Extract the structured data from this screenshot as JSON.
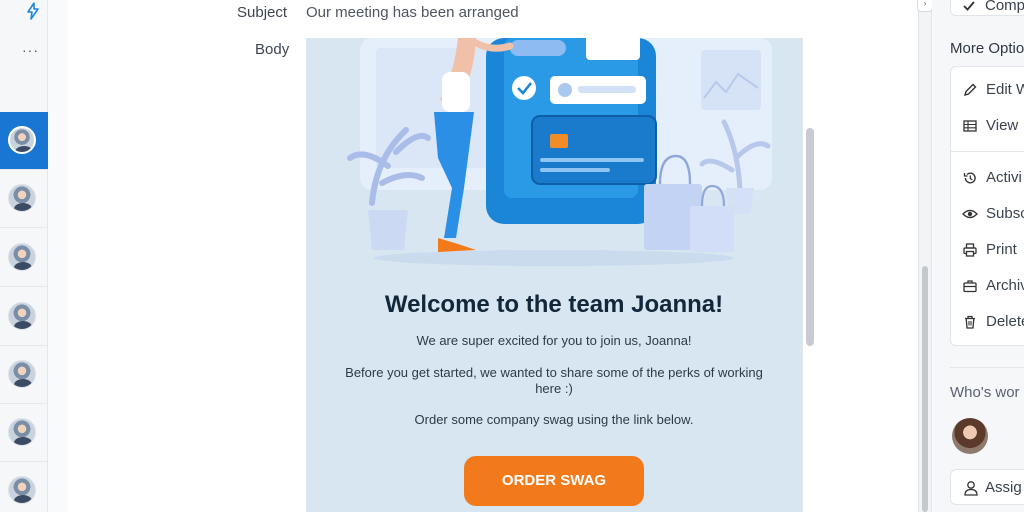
{
  "sidebar": {
    "more_label": "···",
    "threads": [
      {
        "active": true
      },
      {
        "active": false
      },
      {
        "active": false
      },
      {
        "active": false
      },
      {
        "active": false
      },
      {
        "active": false
      },
      {
        "active": false
      }
    ]
  },
  "form": {
    "subject_label": "Subject",
    "subject_value": "Our meeting has been arranged",
    "body_label": "Body"
  },
  "email": {
    "heading": "Welcome to the team Joanna!",
    "line1": "We are super excited for you to join us, Joanna!",
    "line2": "Before you get started, we wanted to share some of the perks of working here :)",
    "line3": "Order some company swag using the link below.",
    "cta_label": "ORDER SWAG",
    "colors": {
      "background": "#d7e6f1",
      "cta": "#f27a1a",
      "heading": "#13273a"
    }
  },
  "right_panel": {
    "top_action": "Comp",
    "more_options_title": "More Optio",
    "items": {
      "edit": "Edit W",
      "view": "View",
      "activity": "Activi",
      "subscribe": "Subsc",
      "print": "Print",
      "archive": "Archiv",
      "delete": "Delete"
    },
    "whos_working_title": "Who's wor",
    "assign_label": "Assig"
  },
  "colors": {
    "accent": "#1976d2",
    "panel_bg": "#f6f7f9"
  }
}
